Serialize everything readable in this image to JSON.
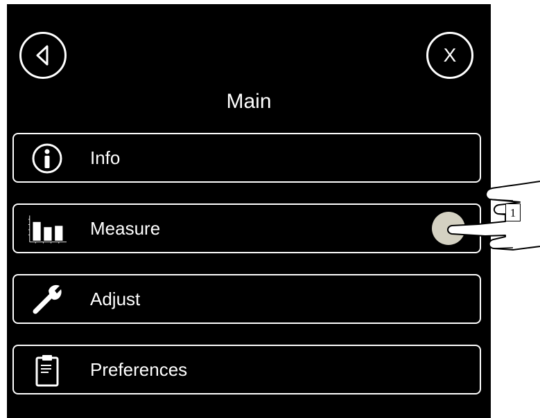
{
  "header": {
    "title": "Main",
    "back_icon": "back-triangle-icon",
    "close_label": "X"
  },
  "menu": {
    "items": [
      {
        "label": "Info",
        "icon": "info-icon"
      },
      {
        "label": "Measure",
        "icon": "bar-chart-icon"
      },
      {
        "label": "Adjust",
        "icon": "wrench-icon"
      },
      {
        "label": "Preferences",
        "icon": "clipboard-icon"
      }
    ]
  },
  "annotation": {
    "step_number": "1",
    "pointer_icon": "pointing-hand-icon",
    "touch_marker": "touch-point-icon"
  },
  "colors": {
    "screen_background": "#000000",
    "foreground": "#ffffff",
    "touch_marker": "#d4d1c2"
  }
}
